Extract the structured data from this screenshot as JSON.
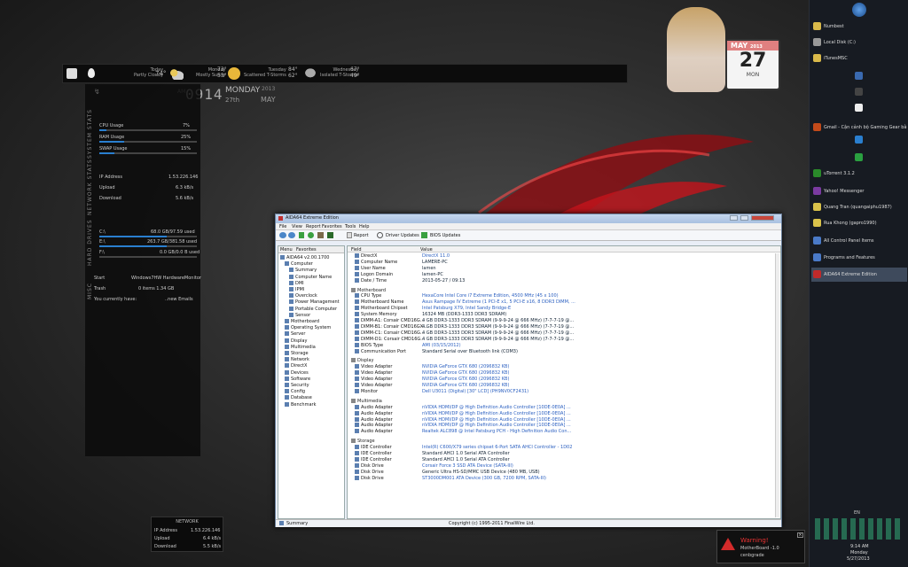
{
  "weather": {
    "days": [
      {
        "label": "Today",
        "cond": "Partly Cloudy",
        "temp": "74°"
      },
      {
        "label": "Monday",
        "cond": "Mostly Sunny",
        "temp": "73°",
        "temp2": "53°"
      },
      {
        "label": "Tuesday",
        "cond": "Scattered T-Storms",
        "temp": "84°",
        "temp2": "62°"
      },
      {
        "label": "Wednesday",
        "cond": "Isolated T-Storms",
        "temp": "67°",
        "temp2": "49°"
      }
    ]
  },
  "clock": {
    "ampm": "AM",
    "time": "0914",
    "day": "MONDAY",
    "date": "27th",
    "year": "2013",
    "month": "MAY"
  },
  "calendar": {
    "month": "MAY",
    "year": "2013",
    "day": "27",
    "dow": "MON"
  },
  "system": {
    "title": "SYSTEM STATS",
    "rows": [
      {
        "label": "CPU Usage",
        "value": "7%",
        "pct": 7
      },
      {
        "label": "RAM Usage",
        "value": "25%",
        "pct": 25
      },
      {
        "label": "SWAP Usage",
        "value": "15%",
        "pct": 15
      }
    ]
  },
  "network": {
    "title": "NETWORK STATS",
    "rows": [
      {
        "label": "IP Address",
        "value": "1.53.226.146"
      },
      {
        "label": "Upload",
        "value": "6.3 kB/s"
      },
      {
        "label": "Download",
        "value": "5.6 kB/s"
      }
    ]
  },
  "drives": {
    "title": "HARD DRIVES",
    "rows": [
      {
        "label": "C:\\",
        "value": "68.0 GB/97.59 used",
        "pct": 69
      },
      {
        "label": "E:\\",
        "value": "263.7 GB/381.58 used",
        "pct": 69
      },
      {
        "label": "F:\\",
        "value": "0.0 GB/0.0 B used",
        "pct": 0
      }
    ]
  },
  "misc": {
    "title": "MISC",
    "rows": [
      {
        "label": "Start",
        "value": "Windows7HW  HardwareMonitor"
      },
      {
        "label": "Trash",
        "value": "0 items   1.34 GB"
      },
      {
        "label": "You currently have:",
        "value": "..new Emails"
      }
    ]
  },
  "netbox": {
    "title": "NETWORK",
    "rows": [
      {
        "label": "IP Address",
        "value": "1.53.226.146"
      },
      {
        "label": "Upload",
        "value": "6.4 kB/s"
      },
      {
        "label": "Download",
        "value": "5.5 kB/s"
      }
    ]
  },
  "aida": {
    "title": "AIDA64 Extreme Edition",
    "menu": [
      "File",
      "View",
      "Report",
      "Favorites",
      "Tools",
      "Help"
    ],
    "toolbar": [
      "Report",
      "Driver Updates",
      "BIOS Updates"
    ],
    "tabs": [
      "Menu",
      "Favorites"
    ],
    "columns": [
      "Field",
      "Value"
    ],
    "tree": [
      "AIDA64 v2.00.1700",
      "Computer",
      "Summary",
      "Computer Name",
      "DMI",
      "IPMI",
      "Overclock",
      "Power Management",
      "Portable Computer",
      "Sensor",
      "Motherboard",
      "Operating System",
      "Server",
      "Display",
      "Multimedia",
      "Storage",
      "Network",
      "DirectX",
      "Devices",
      "Software",
      "Security",
      "Config",
      "Database",
      "Benchmark"
    ],
    "rows": [
      {
        "f": "DirectX",
        "v": "DirectX 11.0",
        "link": true
      },
      {
        "f": "Computer Name",
        "v": "LAMERE-PC"
      },
      {
        "f": "User Name",
        "v": "lamen"
      },
      {
        "f": "Logon Domain",
        "v": "lamen-PC"
      },
      {
        "f": "Date / Time",
        "v": "2013-05-27 / 09:13"
      },
      {
        "s": "Motherboard"
      },
      {
        "f": "CPU Type",
        "v": "HexaCore Intel Core i7 Extreme Edition, 4500 MHz (45 x 100)",
        "link": true
      },
      {
        "f": "Motherboard Name",
        "v": "Asus Rampage IV Extreme  (1 PCI-E x1, 5 PCI-E x16, 8 DDR3 DIMM, ...",
        "link": true
      },
      {
        "f": "Motherboard Chipset",
        "v": "Intel Patsburg X79, Intel Sandy Bridge-E",
        "link": true
      },
      {
        "f": "System Memory",
        "v": "16324 MB  (DDR3-1333 DDR3 SDRAM)"
      },
      {
        "f": "DIMM-A1: Corsair CMD16G...",
        "v": "4 GB DDR3-1333 DDR3 SDRAM  (9-9-9-24 @ 666 MHz)  (7-7-7-19 @..."
      },
      {
        "f": "DIMM-B1: Corsair CMD16GX...",
        "v": "4 GB DDR3-1333 DDR3 SDRAM  (9-9-9-24 @ 666 MHz)  (7-7-7-19 @..."
      },
      {
        "f": "DIMM-C1: Corsair CMD16G...",
        "v": "4 GB DDR3-1333 DDR3 SDRAM  (9-9-9-24 @ 666 MHz)  (7-7-7-19 @..."
      },
      {
        "f": "DIMM-D1: Corsair CMD16G...",
        "v": "4 GB DDR3-1333 DDR3 SDRAM  (9-9-9-24 @ 666 MHz)  (7-7-7-19 @..."
      },
      {
        "f": "BIOS Type",
        "v": "AMI (03/15/2012)",
        "link": true
      },
      {
        "f": "Communication Port",
        "v": "Standard Serial over Bluetooth link (COM3)"
      },
      {
        "s": "Display"
      },
      {
        "f": "Video Adapter",
        "v": "NVIDIA GeForce GTX 680  (2096832 KB)",
        "link": true
      },
      {
        "f": "Video Adapter",
        "v": "NVIDIA GeForce GTX 680  (2096832 KB)",
        "link": true
      },
      {
        "f": "Video Adapter",
        "v": "NVIDIA GeForce GTX 680  (2096832 KB)",
        "link": true
      },
      {
        "f": "Video Adapter",
        "v": "NVIDIA GeForce GTX 680  (2096832 KB)",
        "link": true
      },
      {
        "f": "Monitor",
        "v": "Dell U3011 (Digital)  [30\" LCD]  (PH9NV0CF2431)",
        "link": true
      },
      {
        "s": "Multimedia"
      },
      {
        "f": "Audio Adapter",
        "v": "nVIDIA HDMI/DP @ High Definition Audio Controller [10DE-0E0A] ...",
        "link": true
      },
      {
        "f": "Audio Adapter",
        "v": "nVIDIA HDMI/DP @ High Definition Audio Controller [10DE-0E0A] ...",
        "link": true
      },
      {
        "f": "Audio Adapter",
        "v": "nVIDIA HDMI/DP @ High Definition Audio Controller [10DE-0E0A] ...",
        "link": true
      },
      {
        "f": "Audio Adapter",
        "v": "nVIDIA HDMI/DP @ High Definition Audio Controller [10DE-0E0A] ...",
        "link": true
      },
      {
        "f": "Audio Adapter",
        "v": "Realtek ALC898 @ Intel Patsburg PCH - High Definition Audio Con...",
        "link": true
      },
      {
        "s": "Storage"
      },
      {
        "f": "IDE Controller",
        "v": "Intel(R) C600/X79 series chipset 6-Port SATA AHCI Controller - 1D02",
        "link": true
      },
      {
        "f": "IDE Controller",
        "v": "Standard AHCI 1.0 Serial ATA Controller"
      },
      {
        "f": "IDE Controller",
        "v": "Standard AHCI 1.0 Serial ATA Controller"
      },
      {
        "f": "Disk Drive",
        "v": "Corsair Force 3 SSD ATA Device  (SATA-III)",
        "link": true
      },
      {
        "f": "Disk Drive",
        "v": "Generic Ultra HS-SD/MMC USB Device  (480 MB, USB)"
      },
      {
        "f": "Disk Drive",
        "v": "ST3000DM001 ATA Device  (300 GB, 7200 RPM, SATA-III)",
        "link": true
      }
    ],
    "status_left": "Summary",
    "status_right": "Copyright (c) 1995-2011 FinalWire Ltd."
  },
  "taskbar": {
    "items": [
      "Numbest",
      "Local Disk (C:)",
      "iTunesMSC",
      "",
      "",
      "",
      "Gmail - Cận cảnh bộ Gaming Gear bằng c...",
      "",
      "",
      "uTorrent 3.1.2",
      "Yahoo! Messenger",
      "Quang Tran (quangaiphu1987)",
      "Rua Khong (gapro1990)",
      "All Control Panel Items",
      "Programs and Features",
      "AIDA64 Extreme Edition"
    ],
    "lang": "EN",
    "time": "9:14 AM",
    "day": "Monday",
    "date": "5/27/2013"
  },
  "toast": {
    "title": "Warning!",
    "line1": "MotherBoard -1.0",
    "line2": "cenbgrade"
  }
}
